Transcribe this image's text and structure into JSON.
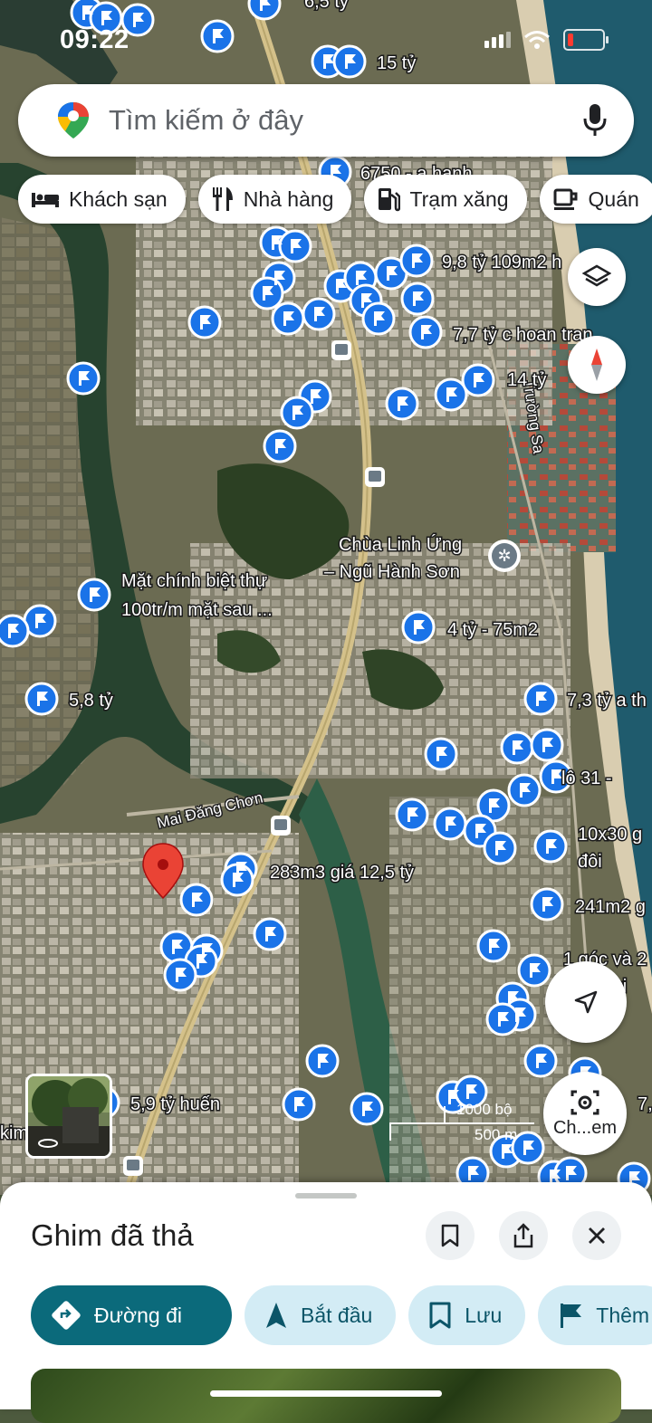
{
  "status_bar": {
    "time": "09:22"
  },
  "search": {
    "placeholder": "Tìm kiếm ở đây"
  },
  "chips": [
    {
      "label": "Khách sạn",
      "icon": "bed-icon"
    },
    {
      "label": "Nhà hàng",
      "icon": "restaurant-icon"
    },
    {
      "label": "Trạm xăng",
      "icon": "gas-station-icon"
    },
    {
      "label": "Quán",
      "icon": "coffee-icon"
    }
  ],
  "map": {
    "labels": [
      {
        "text": "6,5 tỷ"
      },
      {
        "text": "15 tỷ"
      },
      {
        "text": "6750 - a hạnh"
      },
      {
        "text": "9,8 tỷ 109m2 h"
      },
      {
        "text": "7,7 tỷ c hoan tran"
      },
      {
        "text": "14 tỷ"
      },
      {
        "text": "Mặt chính biệt thự"
      },
      {
        "text": "100tr/m mặt sau ..."
      },
      {
        "text": "4 tỷ - 75m2"
      },
      {
        "text": "5,8 tỷ"
      },
      {
        "text": "7,3 tỷ a th"
      },
      {
        "text": "lô 31 -"
      },
      {
        "text": "10x30 g"
      },
      {
        "text": "đôi"
      },
      {
        "text": "283m3 giá 12,5 tỷ"
      },
      {
        "text": "241m2 g"
      },
      {
        "text": "1 góc và 2"
      },
      {
        "text": "n gi"
      },
      {
        "text": "5,9 tỷ huến"
      },
      {
        "text": "7,"
      },
      {
        "text": "kim"
      }
    ],
    "place_name_line1": "Chùa Linh Ứng",
    "place_name_line2": "– Ngũ Hành Sơn",
    "street_truong_sa": "Trường Sa",
    "street_mai_dang_chon": "Mai Đăng Chơn",
    "scale_top": "1000 bộ",
    "scale_bottom": "500 m",
    "lens_label": "Ch...em"
  },
  "sheet": {
    "title": "Ghim đã thả",
    "actions": [
      {
        "label": "Đường đi",
        "icon": "directions-icon"
      },
      {
        "label": "Bắt đầu",
        "icon": "navigation-arrow-icon"
      },
      {
        "label": "Lưu",
        "icon": "bookmark-icon"
      },
      {
        "label": "Thêm",
        "icon": "flag-icon"
      }
    ]
  },
  "colors": {
    "accent": "#0b6a7b",
    "chip_bg": "#d3ecf5",
    "pin_blue": "#1a73e8",
    "dropped_pin": "#ea4335"
  }
}
